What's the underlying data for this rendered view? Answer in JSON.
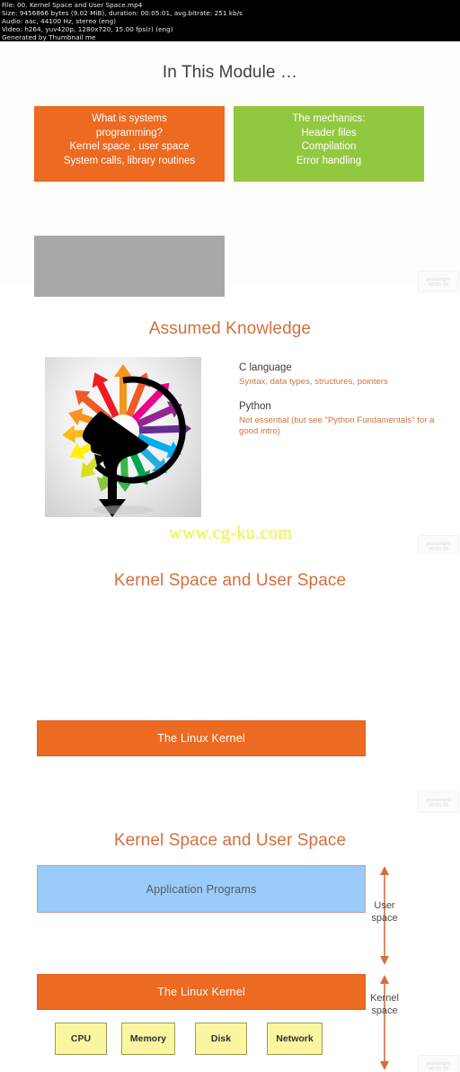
{
  "video_metadata": {
    "lines": [
      "File: 00. Kernel Space and User Space.mp4",
      "Size: 9456866 bytes (9.02 MiB), duration: 00:05:01, avg.bitrate: 251 kb/s",
      "Audio: aac, 44100 Hz, stereo (eng)",
      "Video: h264, yuv420p, 1280x720, 15.00 fps(r) (eng)",
      "Generated by Thumbnail me"
    ]
  },
  "watermarks": {
    "site_url": "www.cg-ku.com",
    "brand_line1": "pluralsight",
    "brand_line2": "00:00:00"
  },
  "colors": {
    "orange": "#ec6a21",
    "green": "#92c840",
    "blue": "#9bcbf8",
    "yellow": "#faf6a0",
    "gray_placeholder": "#a8a8a8",
    "title_accent": "#d2703d",
    "title_dark": "#3e3e3e",
    "arrow": "#d2703d"
  },
  "slides": [
    {
      "id": "in-this-module",
      "title": "In This Module …",
      "left_box": {
        "color": "#ec6a21",
        "lines": [
          "What is systems",
          "programming?",
          "Kernel space , user space",
          "System calls, library routines"
        ]
      },
      "right_box": {
        "color": "#92c840",
        "lines": [
          "The mechanics:",
          "Header files",
          "Compilation",
          "Error handling"
        ]
      },
      "placeholder": {
        "color": "#a8a8a8",
        "label": ""
      }
    },
    {
      "id": "assumed-knowledge",
      "title": "Assumed Knowledge",
      "image_alt": "head silhouette with colorful radiating arrows",
      "items": [
        {
          "heading": "C language",
          "detail": "Syntax, data types, structures, pointers"
        },
        {
          "heading": "Python",
          "detail": "Not essential (but see \"Python Fundamentals\" for a good intro)"
        }
      ]
    },
    {
      "id": "kernel-space-user-space-1",
      "title": "Kernel Space and User Space",
      "kernel_bar": "The Linux Kernel"
    },
    {
      "id": "kernel-space-user-space-2",
      "title": "Kernel Space and User Space",
      "app_bar": "Application Programs",
      "kernel_bar": "The Linux Kernel",
      "user_space_label": "User\nspace",
      "user_space_label_l1": "User",
      "user_space_label_l2": "space",
      "kernel_space_label_l1": "Kernel",
      "kernel_space_label_l2": "space",
      "hardware": [
        "CPU",
        "Memory",
        "Disk",
        "Network"
      ]
    }
  ]
}
